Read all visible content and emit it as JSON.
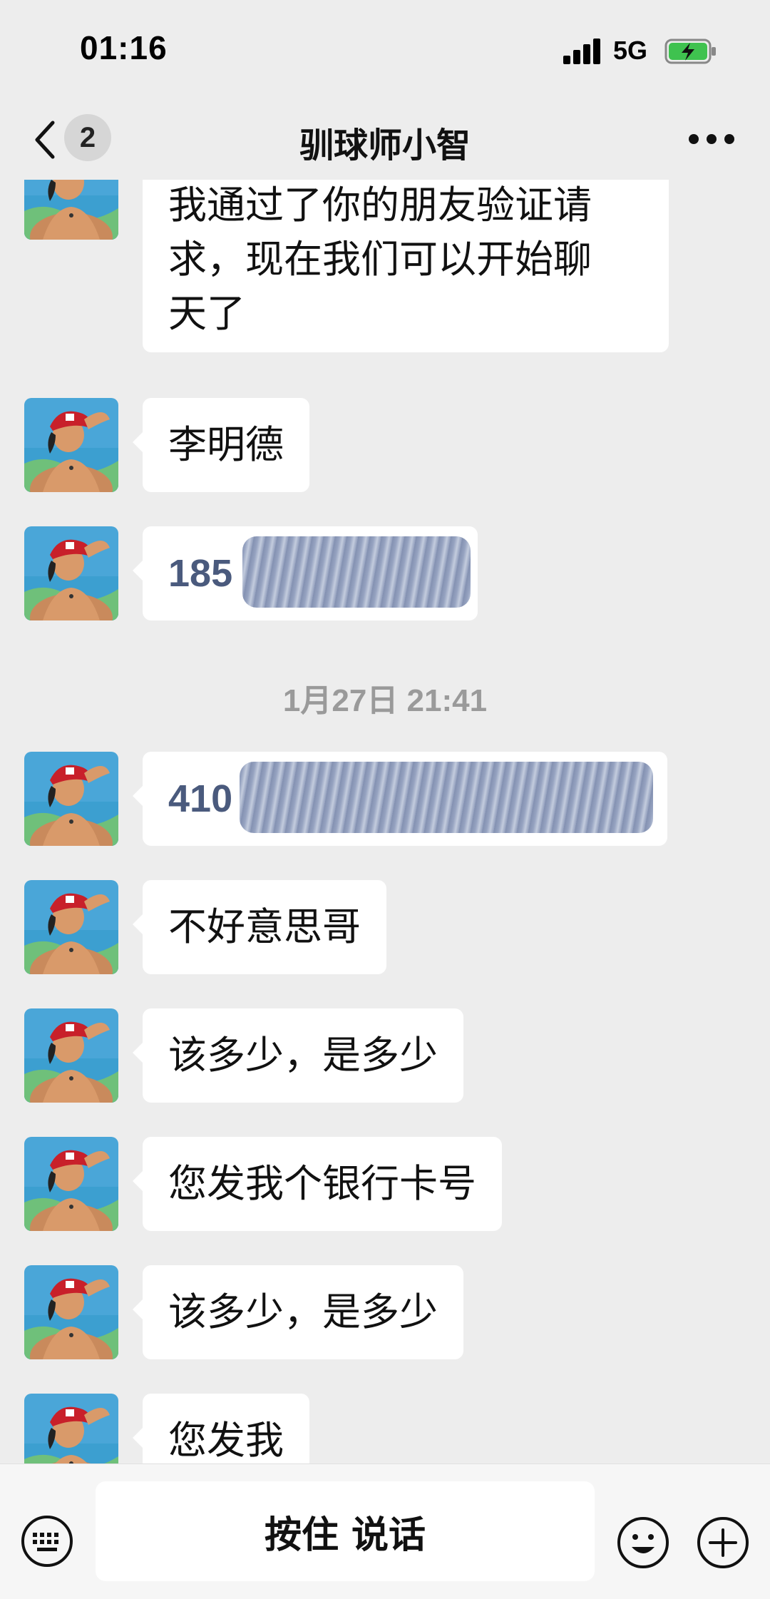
{
  "status_bar": {
    "time": "01:16",
    "network": "5G"
  },
  "nav": {
    "unread_count": "2",
    "title": "驯球师小智"
  },
  "messages": [
    {
      "type": "text",
      "text": "我通过了你的朋友验证请求，现在我们可以开始聊天了",
      "lines": [
        "我通过了你的朋友验证请",
        "求，现在我们可以开始聊",
        "天了"
      ]
    },
    {
      "type": "text",
      "text": "李明德"
    },
    {
      "type": "redacted",
      "visible_prefix": "185"
    },
    {
      "type": "time",
      "text": "1月27日 21:41"
    },
    {
      "type": "redacted",
      "visible_prefix": "410"
    },
    {
      "type": "text",
      "text": "不好意思哥"
    },
    {
      "type": "text",
      "text": "该多少，是多少"
    },
    {
      "type": "text",
      "text": "您发我个银行卡号"
    },
    {
      "type": "text",
      "text": "该多少，是多少"
    },
    {
      "type": "text",
      "text": "您发我"
    }
  ],
  "input_bar": {
    "hold_to_talk": "按住 说话"
  },
  "icons": [
    "chevron-left-icon",
    "more-icon",
    "keyboard-icon",
    "emoji-icon",
    "plus-icon",
    "signal-icon",
    "battery-charging-icon"
  ]
}
